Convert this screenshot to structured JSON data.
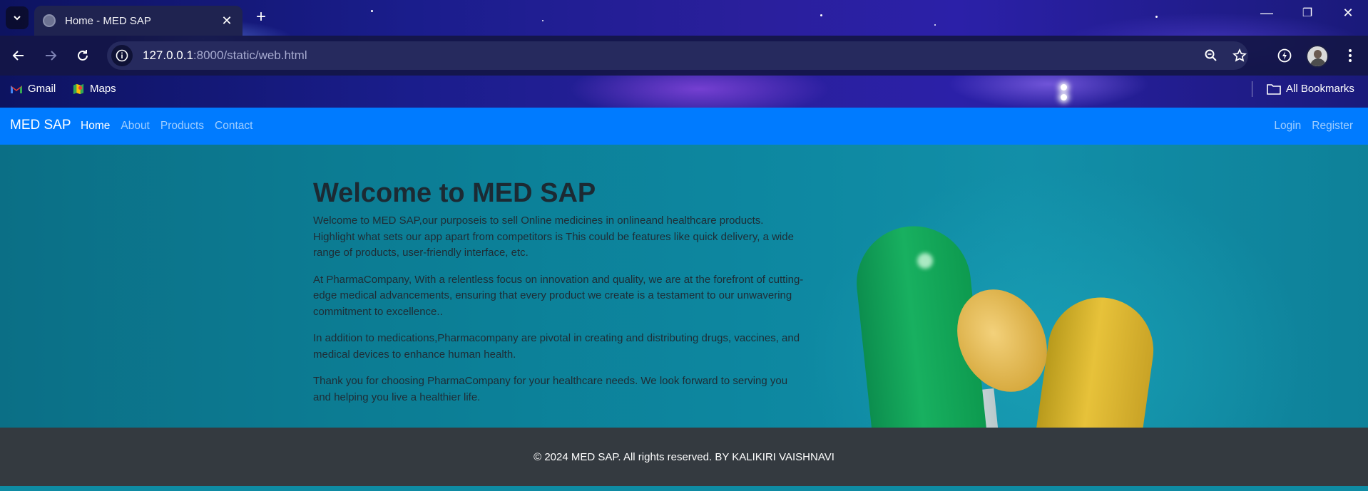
{
  "browser": {
    "tab_title": "Home - MED SAP",
    "url_host": "127.0.0.1",
    "url_rest": ":8000/static/web.html",
    "bookmarks": [
      {
        "label": "Gmail",
        "icon": "gmail-icon"
      },
      {
        "label": "Maps",
        "icon": "maps-icon"
      }
    ],
    "all_bookmarks_label": "All Bookmarks"
  },
  "navbar": {
    "brand": "MED SAP",
    "links": [
      "Home",
      "About",
      "Products",
      "Contact"
    ],
    "active_link": "Home",
    "right_links": [
      "Login",
      "Register"
    ],
    "color": "#007bff"
  },
  "hero": {
    "heading": "Welcome to MED SAP",
    "paragraphs": [
      "Welcome to MED SAP,our purposeis to sell Online medicines in onlineand healthcare products. Highlight what sets our app apart from competitors is This could be features like quick delivery, a wide range of products, user-friendly interface, etc.",
      "At PharmaCompany, With a relentless focus on innovation and quality, we are at the forefront of cutting-edge medical advancements, ensuring that every product we create is a testament to our unwavering commitment to excellence..",
      "In addition to medications,Pharmacompany are pivotal in creating and distributing drugs, vaccines, and medical devices to enhance human health.",
      "Thank you for choosing PharmaCompany for your healthcare needs. We look forward to serving you and helping you live a healthier life."
    ]
  },
  "footer": {
    "text": "© 2024 MED SAP. All rights reserved. BY KALIKIRI VAISHNAVI",
    "color": "#343a40"
  }
}
